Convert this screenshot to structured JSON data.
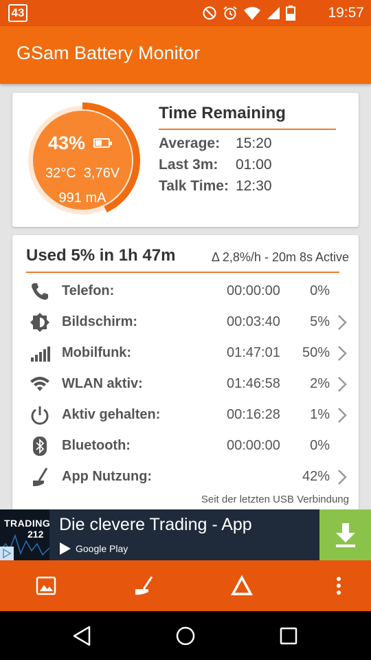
{
  "status_bar": {
    "badge": "43",
    "time": "19:57",
    "icons": [
      "do-not-disturb-icon",
      "alarm-icon",
      "wifi-icon",
      "signal-icon",
      "battery-icon"
    ]
  },
  "app_bar": {
    "title": "GSam Battery Monitor"
  },
  "battery": {
    "percent_label": "43%",
    "level": 0.43,
    "temperature": "32°C",
    "voltage": "3,76V",
    "current": "991 mA"
  },
  "time_remaining": {
    "title": "Time Remaining",
    "rows": [
      {
        "label": "Average:",
        "value": "15:20"
      },
      {
        "label": "Last 3m:",
        "value": "01:00"
      },
      {
        "label": "Talk Time:",
        "value": "12:30"
      }
    ]
  },
  "usage": {
    "title": "Used 5% in 1h 47m",
    "delta": "Δ 2,8%/h - 20m 8s Active",
    "rows": [
      {
        "icon": "phone-icon",
        "label": "Telefon:",
        "time": "00:00:00",
        "pct": "0%",
        "chevron": false
      },
      {
        "icon": "screen-brightness-icon",
        "label": "Bildschirm:",
        "time": "00:03:40",
        "pct": "5%",
        "chevron": true
      },
      {
        "icon": "cell-signal-icon",
        "label": "Mobilfunk:",
        "time": "01:47:01",
        "pct": "50%",
        "chevron": true
      },
      {
        "icon": "wifi-icon",
        "label": "WLAN aktiv:",
        "time": "01:46:58",
        "pct": "2%",
        "chevron": true
      },
      {
        "icon": "power-icon",
        "label": "Aktiv gehalten:",
        "time": "00:16:28",
        "pct": "1%",
        "chevron": true
      },
      {
        "icon": "bluetooth-icon",
        "label": "Bluetooth:",
        "time": "00:00:00",
        "pct": "0%",
        "chevron": false
      },
      {
        "icon": "broom-icon",
        "label": "App Nutzung:",
        "time": "",
        "pct": "42%",
        "chevron": true
      }
    ],
    "note": "Seit der letzten USB Verbindung"
  },
  "ad": {
    "logo_line1": "TRADING",
    "logo_line2": "212",
    "title": "Die clevere Trading - App",
    "store": "Google Play",
    "accent": "#8bc34a"
  },
  "toolbar": {
    "buttons": [
      "image-icon",
      "broom-icon",
      "triangle-icon",
      "more-vert-icon"
    ]
  },
  "colors": {
    "primary": "#f06c0f",
    "primary_dark": "#e6560c",
    "accent_line": "#f07a2a"
  }
}
